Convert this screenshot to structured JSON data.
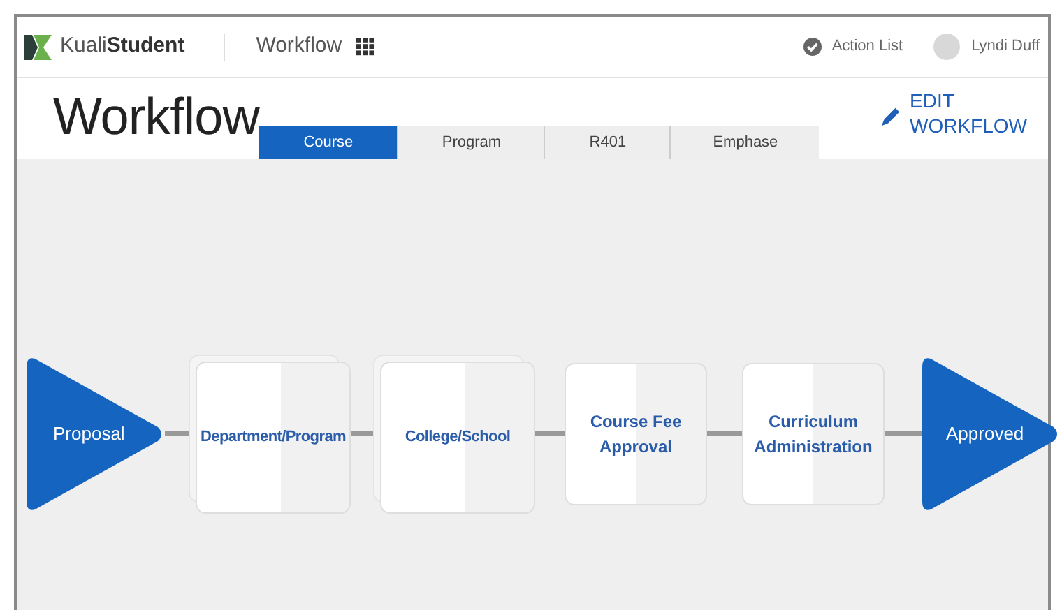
{
  "navbar": {
    "brand": {
      "light": "Kuali",
      "bold": "Student"
    },
    "app_title": "Workflow",
    "action_list": "Action List",
    "user": "Lyndi Duff"
  },
  "header": {
    "title": "Workflow",
    "edit_link": "EDIT WORKFLOW"
  },
  "tabs": [
    {
      "label": "Course",
      "selected": true
    },
    {
      "label": "Program",
      "selected": false
    },
    {
      "label": "R401",
      "selected": false
    },
    {
      "label": "Emphase",
      "selected": false
    }
  ],
  "workflow": {
    "nodes": [
      {
        "kind": "start",
        "label": "Proposal"
      },
      {
        "kind": "stack",
        "label": "Department/Program"
      },
      {
        "kind": "stack",
        "label": "College/School"
      },
      {
        "kind": "single",
        "label": "Course Fee Approval"
      },
      {
        "kind": "single",
        "label": "Curriculum Administration"
      },
      {
        "kind": "end",
        "label": "Approved"
      }
    ]
  }
}
